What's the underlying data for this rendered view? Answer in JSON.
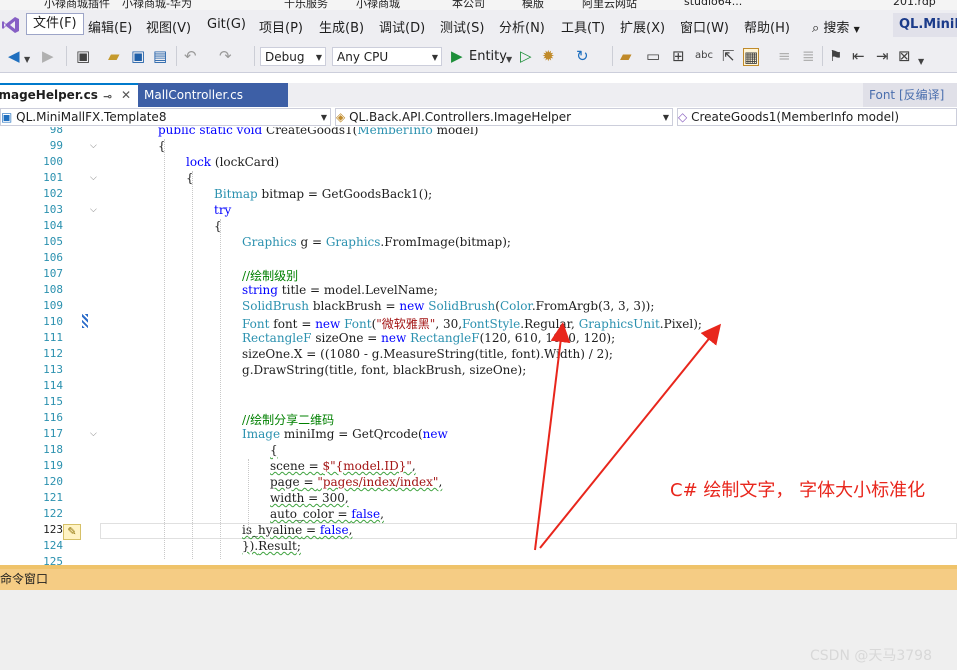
{
  "bookmarks": [
    "小禄商城插件",
    "小禄商城-华为",
    "千乐服务",
    "小禄商城",
    "本公司",
    "模版",
    "阿里云网站",
    "studio64...",
    "201.rdp"
  ],
  "menu": {
    "items": [
      "文件(F)",
      "编辑(E)",
      "视图(V)",
      "Git(G)",
      "项目(P)",
      "生成(B)",
      "调试(D)",
      "测试(S)",
      "分析(N)",
      "工具(T)",
      "扩展(X)",
      "窗口(W)",
      "帮助(H)"
    ],
    "search_label": "搜索",
    "solution_title": "QL.MiniMallFX"
  },
  "toolbar": {
    "config": "Debug",
    "platform": "Any CPU",
    "run_target": "Entity"
  },
  "tabs": {
    "active": "ImageHelper.cs",
    "inactive": "MallController.cs",
    "preview": "Font [反编译]"
  },
  "navbar": {
    "project": "QL.MiniMallFX.Template8",
    "class": "QL.Back.API.Controllers.ImageHelper",
    "member": "CreateGoods1(MemberInfo model)"
  },
  "editor": {
    "lines": [
      {
        "no": "98",
        "text": "public static void CreateGoods1(MemberInfo model)"
      },
      {
        "no": "99",
        "text": "{"
      },
      {
        "no": "100",
        "text": "lock (lockCard)"
      },
      {
        "no": "101",
        "text": "{"
      },
      {
        "no": "102",
        "text": "Bitmap bitmap = GetGoodsBack1();"
      },
      {
        "no": "103",
        "text": "try"
      },
      {
        "no": "104",
        "text": "{"
      },
      {
        "no": "105",
        "text": "Graphics g = Graphics.FromImage(bitmap);"
      },
      {
        "no": "106",
        "text": ""
      },
      {
        "no": "107",
        "text": "//绘制级别"
      },
      {
        "no": "108",
        "text": "string title = model.LevelName;"
      },
      {
        "no": "109",
        "text": "SolidBrush blackBrush = new SolidBrush(Color.FromArgb(3, 3, 3));"
      },
      {
        "no": "110",
        "text": "Font font = new Font(\"微软雅黑\", 30,FontStyle.Regular, GraphicsUnit.Pixel);"
      },
      {
        "no": "111",
        "text": "RectangleF sizeOne = new RectangleF(120, 610, 1080, 120);"
      },
      {
        "no": "112",
        "text": "sizeOne.X = ((1080 - g.MeasureString(title, font).Width) / 2);"
      },
      {
        "no": "113",
        "text": "g.DrawString(title, font, blackBrush, sizeOne);"
      },
      {
        "no": "114",
        "text": ""
      },
      {
        "no": "115",
        "text": ""
      },
      {
        "no": "116",
        "text": "//绘制分享二维码"
      },
      {
        "no": "117",
        "text": "Image miniImg = GetQrcode(new"
      },
      {
        "no": "118",
        "text": "{"
      },
      {
        "no": "119",
        "text": "scene = $\"{model.ID}\","
      },
      {
        "no": "120",
        "text": "page = \"pages/index/index\","
      },
      {
        "no": "121",
        "text": "width = 300,"
      },
      {
        "no": "122",
        "text": "auto_color = false,"
      },
      {
        "no": "123",
        "text": "is_hyaline = false,"
      },
      {
        "no": "124",
        "text": "}).Result;"
      },
      {
        "no": "125",
        "text": ""
      }
    ]
  },
  "annotation": {
    "text": "C# 绘制文字， 字体大小标准化",
    "color": "#e8261c"
  },
  "command_window": {
    "title": "命令窗口"
  },
  "watermark": "CSDN @天马3798",
  "colors": {
    "accent": "#007acc",
    "tab_inactive": "#3d5fa6",
    "command_bar": "#f5cc84",
    "keyword": "#0000ff",
    "type": "#2b91af",
    "comment": "#008000",
    "string": "#a31515"
  },
  "icons": [
    "vs-logo-icon",
    "back-icon",
    "forward-icon",
    "new-item-icon",
    "open-icon",
    "save-icon",
    "save-all-icon",
    "undo-icon",
    "redo-icon",
    "start-icon",
    "start-without-debug-icon",
    "hot-reload-icon",
    "refresh-icon",
    "lightbulb-icon",
    "pencil-change-icon",
    "chevron-down-icon"
  ]
}
